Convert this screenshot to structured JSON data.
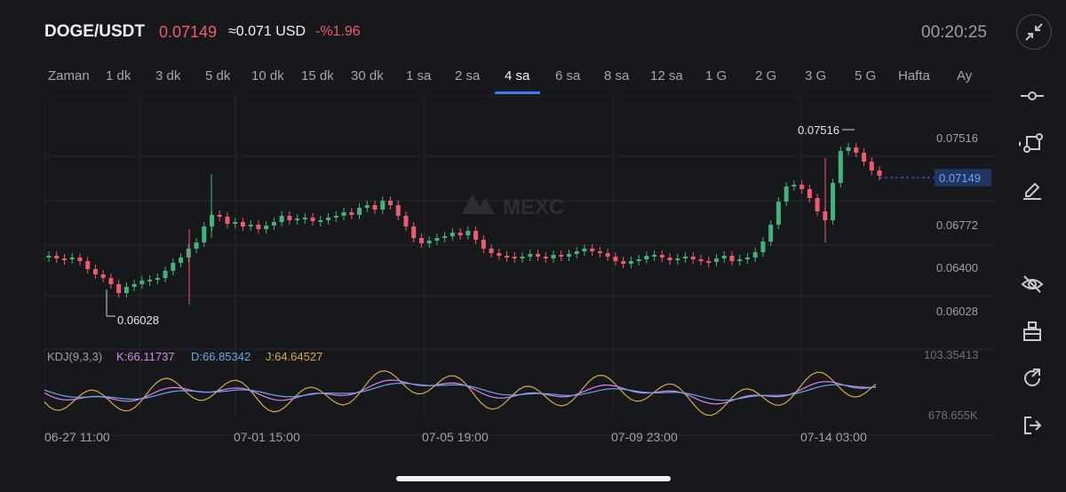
{
  "header": {
    "pair": "DOGE/USDT",
    "price": "0.07149",
    "usd_equiv": "≈0.071 USD",
    "change_pct": "-%1.96",
    "clock": "00:20:25",
    "collapse_icon": "collapse-arrows-icon"
  },
  "tabs": [
    {
      "label": "Zaman"
    },
    {
      "label": "1 dk"
    },
    {
      "label": "3 dk"
    },
    {
      "label": "5 dk"
    },
    {
      "label": "10 dk"
    },
    {
      "label": "15 dk"
    },
    {
      "label": "30 dk"
    },
    {
      "label": "1 sa"
    },
    {
      "label": "2 sa"
    },
    {
      "label": "4 sa",
      "active": true
    },
    {
      "label": "6 sa"
    },
    {
      "label": "8 sa"
    },
    {
      "label": "12 sa"
    },
    {
      "label": "1 G"
    },
    {
      "label": "2 G"
    },
    {
      "label": "3 G"
    },
    {
      "label": "5 G"
    },
    {
      "label": "Hafta"
    },
    {
      "label": "Ay"
    }
  ],
  "chart": {
    "watermark": "MEXC",
    "price_axis": [
      "0.07516",
      "0.06772",
      "0.06400",
      "0.06028"
    ],
    "current_price_tag": "0.07149",
    "high_label": "0.07516",
    "low_label": "0.06028",
    "kdj": {
      "name": "KDJ(9,3,3)",
      "k": "K:66.11737",
      "d": "D:66.85342",
      "j": "J:64.64527"
    },
    "volume_axis_top": "103.35413",
    "volume_axis_bottom": "678.655K",
    "time_axis": [
      "06-27 11:00",
      "07-01 15:00",
      "07-05 19:00",
      "07-09 23:00",
      "07-14 03:00"
    ],
    "colors": {
      "up": "#41b47d",
      "down": "#ef5b6d",
      "k": "#d685ea",
      "d": "#6fa4e8",
      "j": "#d8a94b",
      "accent": "#3b7bf6"
    }
  },
  "sidebar": [
    {
      "icon": "horizontal-line-tool-icon"
    },
    {
      "icon": "shape-tool-icon"
    },
    {
      "icon": "pencil-icon"
    },
    {
      "icon": "hide-eye-icon"
    },
    {
      "icon": "clear-broom-icon"
    },
    {
      "icon": "refresh-icon"
    },
    {
      "icon": "exit-icon"
    }
  ],
  "chart_data": {
    "type": "line",
    "title": "",
    "x": [
      "06-27 11:00",
      "07-01 15:00",
      "07-05 19:00",
      "07-09 23:00",
      "07-14 03:00"
    ],
    "series": [],
    "ylim": [
      0.06028,
      0.07516
    ],
    "high": 0.07516,
    "low": 0.06028,
    "last": 0.07149
  }
}
